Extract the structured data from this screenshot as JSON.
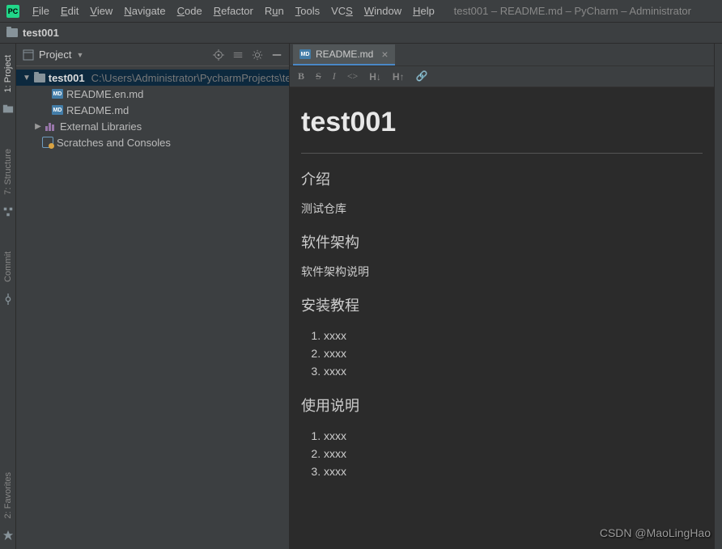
{
  "menubar": {
    "items": [
      "File",
      "Edit",
      "View",
      "Navigate",
      "Code",
      "Refactor",
      "Run",
      "Tools",
      "VCS",
      "Window",
      "Help"
    ],
    "window_title": "test001 – README.md – PyCharm – Administrator"
  },
  "breadcrumb": {
    "text": "test001"
  },
  "sidebar_left": {
    "tabs": [
      "1: Project",
      "7: Structure",
      "Commit",
      "2: Favorites"
    ]
  },
  "project_panel": {
    "title": "Project",
    "root": {
      "name": "test001",
      "path": "C:\\Users\\Administrator\\PycharmProjects\\te"
    },
    "files": [
      "README.en.md",
      "README.md"
    ],
    "extras": [
      "External Libraries",
      "Scratches and Consoles"
    ]
  },
  "editor": {
    "tab": "README.md",
    "md_tools": [
      "B",
      "S",
      "I",
      "<>",
      "H↓",
      "H↑",
      "🔗"
    ]
  },
  "preview": {
    "h1": "test001",
    "sections": [
      {
        "heading": "介绍",
        "text": "测试仓库",
        "list": null
      },
      {
        "heading": "软件架构",
        "text": "软件架构说明",
        "list": null
      },
      {
        "heading": "安装教程",
        "text": null,
        "list": [
          "xxxx",
          "xxxx",
          "xxxx"
        ]
      },
      {
        "heading": "使用说明",
        "text": null,
        "list": [
          "xxxx",
          "xxxx",
          "xxxx"
        ]
      }
    ]
  },
  "watermark": "CSDN @MaoLingHao"
}
